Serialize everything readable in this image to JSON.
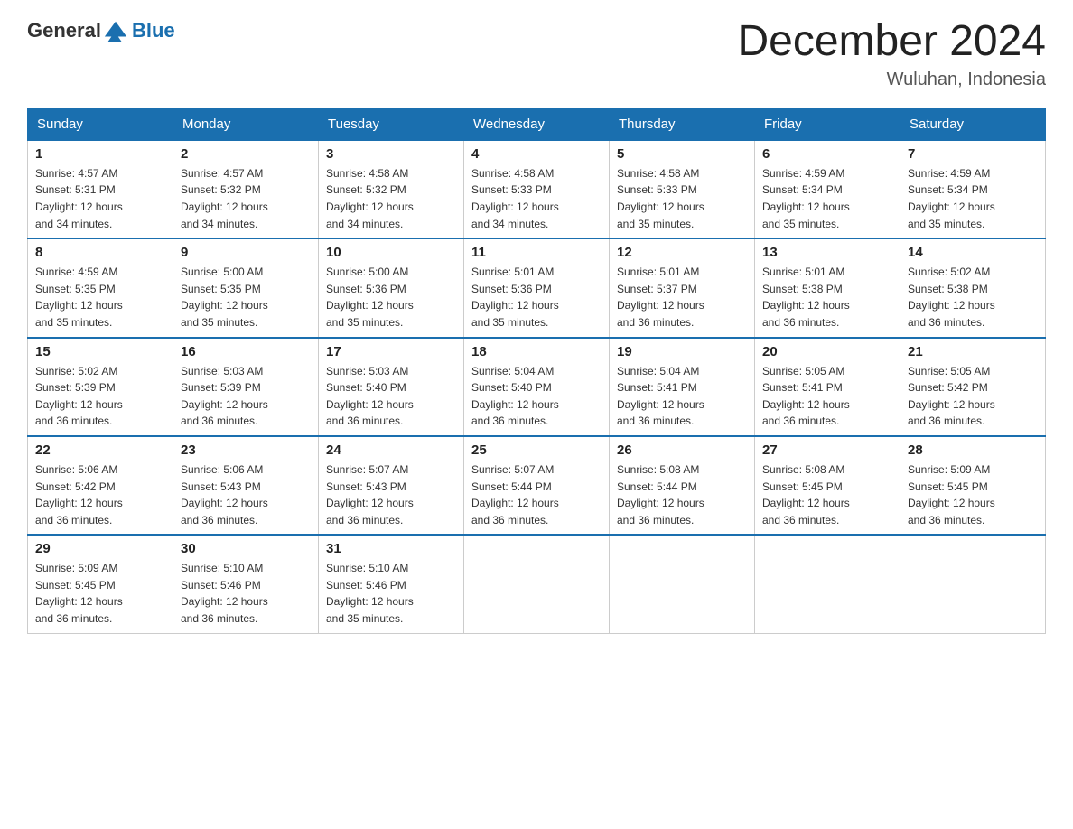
{
  "header": {
    "logo_general": "General",
    "logo_blue": "Blue",
    "month_title": "December 2024",
    "location": "Wuluhan, Indonesia"
  },
  "days_of_week": [
    "Sunday",
    "Monday",
    "Tuesday",
    "Wednesday",
    "Thursday",
    "Friday",
    "Saturday"
  ],
  "weeks": [
    [
      {
        "day": "1",
        "sunrise": "4:57 AM",
        "sunset": "5:31 PM",
        "daylight": "12 hours and 34 minutes."
      },
      {
        "day": "2",
        "sunrise": "4:57 AM",
        "sunset": "5:32 PM",
        "daylight": "12 hours and 34 minutes."
      },
      {
        "day": "3",
        "sunrise": "4:58 AM",
        "sunset": "5:32 PM",
        "daylight": "12 hours and 34 minutes."
      },
      {
        "day": "4",
        "sunrise": "4:58 AM",
        "sunset": "5:33 PM",
        "daylight": "12 hours and 34 minutes."
      },
      {
        "day": "5",
        "sunrise": "4:58 AM",
        "sunset": "5:33 PM",
        "daylight": "12 hours and 35 minutes."
      },
      {
        "day": "6",
        "sunrise": "4:59 AM",
        "sunset": "5:34 PM",
        "daylight": "12 hours and 35 minutes."
      },
      {
        "day": "7",
        "sunrise": "4:59 AM",
        "sunset": "5:34 PM",
        "daylight": "12 hours and 35 minutes."
      }
    ],
    [
      {
        "day": "8",
        "sunrise": "4:59 AM",
        "sunset": "5:35 PM",
        "daylight": "12 hours and 35 minutes."
      },
      {
        "day": "9",
        "sunrise": "5:00 AM",
        "sunset": "5:35 PM",
        "daylight": "12 hours and 35 minutes."
      },
      {
        "day": "10",
        "sunrise": "5:00 AM",
        "sunset": "5:36 PM",
        "daylight": "12 hours and 35 minutes."
      },
      {
        "day": "11",
        "sunrise": "5:01 AM",
        "sunset": "5:36 PM",
        "daylight": "12 hours and 35 minutes."
      },
      {
        "day": "12",
        "sunrise": "5:01 AM",
        "sunset": "5:37 PM",
        "daylight": "12 hours and 36 minutes."
      },
      {
        "day": "13",
        "sunrise": "5:01 AM",
        "sunset": "5:38 PM",
        "daylight": "12 hours and 36 minutes."
      },
      {
        "day": "14",
        "sunrise": "5:02 AM",
        "sunset": "5:38 PM",
        "daylight": "12 hours and 36 minutes."
      }
    ],
    [
      {
        "day": "15",
        "sunrise": "5:02 AM",
        "sunset": "5:39 PM",
        "daylight": "12 hours and 36 minutes."
      },
      {
        "day": "16",
        "sunrise": "5:03 AM",
        "sunset": "5:39 PM",
        "daylight": "12 hours and 36 minutes."
      },
      {
        "day": "17",
        "sunrise": "5:03 AM",
        "sunset": "5:40 PM",
        "daylight": "12 hours and 36 minutes."
      },
      {
        "day": "18",
        "sunrise": "5:04 AM",
        "sunset": "5:40 PM",
        "daylight": "12 hours and 36 minutes."
      },
      {
        "day": "19",
        "sunrise": "5:04 AM",
        "sunset": "5:41 PM",
        "daylight": "12 hours and 36 minutes."
      },
      {
        "day": "20",
        "sunrise": "5:05 AM",
        "sunset": "5:41 PM",
        "daylight": "12 hours and 36 minutes."
      },
      {
        "day": "21",
        "sunrise": "5:05 AM",
        "sunset": "5:42 PM",
        "daylight": "12 hours and 36 minutes."
      }
    ],
    [
      {
        "day": "22",
        "sunrise": "5:06 AM",
        "sunset": "5:42 PM",
        "daylight": "12 hours and 36 minutes."
      },
      {
        "day": "23",
        "sunrise": "5:06 AM",
        "sunset": "5:43 PM",
        "daylight": "12 hours and 36 minutes."
      },
      {
        "day": "24",
        "sunrise": "5:07 AM",
        "sunset": "5:43 PM",
        "daylight": "12 hours and 36 minutes."
      },
      {
        "day": "25",
        "sunrise": "5:07 AM",
        "sunset": "5:44 PM",
        "daylight": "12 hours and 36 minutes."
      },
      {
        "day": "26",
        "sunrise": "5:08 AM",
        "sunset": "5:44 PM",
        "daylight": "12 hours and 36 minutes."
      },
      {
        "day": "27",
        "sunrise": "5:08 AM",
        "sunset": "5:45 PM",
        "daylight": "12 hours and 36 minutes."
      },
      {
        "day": "28",
        "sunrise": "5:09 AM",
        "sunset": "5:45 PM",
        "daylight": "12 hours and 36 minutes."
      }
    ],
    [
      {
        "day": "29",
        "sunrise": "5:09 AM",
        "sunset": "5:45 PM",
        "daylight": "12 hours and 36 minutes."
      },
      {
        "day": "30",
        "sunrise": "5:10 AM",
        "sunset": "5:46 PM",
        "daylight": "12 hours and 36 minutes."
      },
      {
        "day": "31",
        "sunrise": "5:10 AM",
        "sunset": "5:46 PM",
        "daylight": "12 hours and 35 minutes."
      },
      null,
      null,
      null,
      null
    ]
  ],
  "labels": {
    "sunrise_prefix": "Sunrise: ",
    "sunset_prefix": "Sunset: ",
    "daylight_prefix": "Daylight: "
  }
}
